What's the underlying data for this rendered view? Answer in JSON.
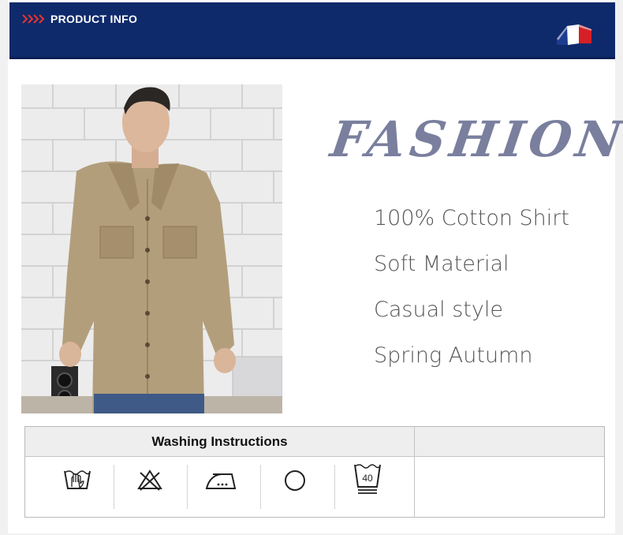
{
  "header": {
    "title": "PRODUCT INFO",
    "accent_color": "#e8342e",
    "background_color": "#0f2a6b",
    "flag_colors": [
      "#1d3b8f",
      "#ffffff",
      "#d62027"
    ]
  },
  "main": {
    "headline": "FASHION",
    "features": [
      "100% Cotton Shirt",
      "Soft Material",
      "Casual style",
      "Spring Autumn"
    ]
  },
  "washing": {
    "title": "Washing Instructions",
    "icons": [
      {
        "name": "hand-wash-icon"
      },
      {
        "name": "do-not-bleach-icon"
      },
      {
        "name": "iron-low-heat-icon"
      },
      {
        "name": "tumble-dry-icon"
      },
      {
        "name": "wash-40-icon",
        "label": "40"
      }
    ]
  }
}
